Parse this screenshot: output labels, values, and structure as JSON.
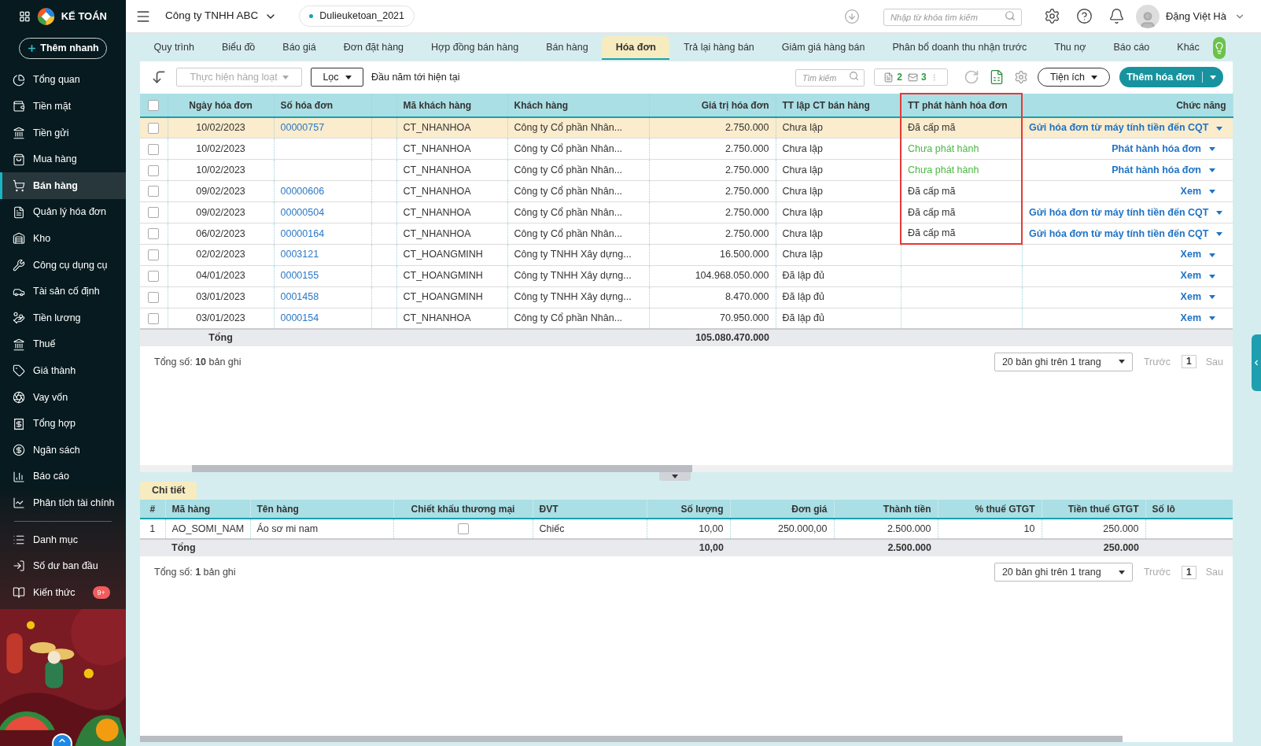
{
  "topbar": {
    "app_name": "KẾ TOÁN",
    "company": "Công ty TNHH ABC",
    "database": "Dulieuketoan_2021",
    "search_placeholder": "Nhập từ khóa tìm kiếm",
    "user": "Đặng Việt Hà"
  },
  "sidebar": {
    "quick_add": "Thêm nhanh",
    "sections": [
      {
        "items": [
          {
            "label": "Tổng quan",
            "selected": false
          },
          {
            "label": "Tiền mặt",
            "selected": false
          },
          {
            "label": "Tiền gửi",
            "selected": false
          },
          {
            "label": "Mua hàng",
            "selected": false
          },
          {
            "label": "Bán hàng",
            "selected": true
          },
          {
            "label": "Quản lý hóa đơn",
            "selected": false
          },
          {
            "label": "Kho",
            "selected": false
          },
          {
            "label": "Công cụ dụng cụ",
            "selected": false
          },
          {
            "label": "Tài sản cố định",
            "selected": false
          },
          {
            "label": "Tiền lương",
            "selected": false
          },
          {
            "label": "Thuế",
            "selected": false
          },
          {
            "label": "Giá thành",
            "selected": false
          },
          {
            "label": "Vay vốn",
            "selected": false
          },
          {
            "label": "Tổng hợp",
            "selected": false
          },
          {
            "label": "Ngân sách",
            "selected": false
          },
          {
            "label": "Báo cáo",
            "selected": false
          },
          {
            "label": "Phân tích tài chính",
            "selected": false
          }
        ]
      },
      {
        "items": [
          {
            "label": "Danh mục",
            "selected": false
          },
          {
            "label": "Số dư ban đầu",
            "selected": false
          },
          {
            "label": "Kiến thức",
            "selected": false,
            "badge": "9+"
          }
        ]
      }
    ]
  },
  "tabs": [
    {
      "label": "Quy trình",
      "selected": false
    },
    {
      "label": "Biểu đồ",
      "selected": false
    },
    {
      "label": "Báo giá",
      "selected": false
    },
    {
      "label": "Đơn đặt hàng",
      "selected": false
    },
    {
      "label": "Hợp đồng bán hàng",
      "selected": false
    },
    {
      "label": "Bán hàng",
      "selected": false
    },
    {
      "label": "Hóa đơn",
      "selected": true
    },
    {
      "label": "Trả lại hàng bán",
      "selected": false
    },
    {
      "label": "Giảm giá hàng bán",
      "selected": false
    },
    {
      "label": "Phân bổ doanh thu nhận trước",
      "selected": false
    },
    {
      "label": "Thu nợ",
      "selected": false
    },
    {
      "label": "Báo cáo",
      "selected": false
    },
    {
      "label": "Khác",
      "selected": false
    }
  ],
  "toolbar": {
    "bulk_action": "Thực hiện hàng loạt",
    "filter": "Lọc",
    "period": "Đầu năm tới hiện tại",
    "search_placeholder": "Tìm kiếm",
    "doc_count": "2",
    "mail_count": "3",
    "utilities": "Tiện ích",
    "add_button": "Thêm hóa đơn"
  },
  "table": {
    "select_all_checked": false,
    "columns": [
      {
        "label": "Ngày hóa đơn"
      },
      {
        "label": "Số hóa đơn"
      },
      {
        "label": "Mã khách hàng"
      },
      {
        "label": "Khách hàng"
      },
      {
        "label": "Giá trị hóa đơn"
      },
      {
        "label": "TT lập CT bán hàng"
      },
      {
        "label": "TT phát hành hóa đơn",
        "highlighted": true
      },
      {
        "label": "Chức năng"
      }
    ],
    "rows": [
      {
        "selected": true,
        "checked": false,
        "date": "10/02/2023",
        "number": "00000757",
        "customer_code": "CT_NHANHOA",
        "customer": "Công ty Cổ phần Nhân...",
        "amount": "2.750.000",
        "entry_status": "Chưa lập",
        "issue_status": {
          "text": "Đã cấp mã",
          "color": "#333333"
        },
        "issue_highlighted": true,
        "action": "Gửi hóa đơn từ máy tính tiền đến CQT"
      },
      {
        "selected": false,
        "checked": false,
        "date": "10/02/2023",
        "customer_code": "CT_NHANHOA",
        "customer": "Công ty Cổ phần Nhân...",
        "amount": "2.750.000",
        "entry_status": "Chưa lập",
        "issue_status": {
          "text": "Chưa phát hành",
          "color": "#4cb843"
        },
        "issue_highlighted": true,
        "action": "Phát hành hóa đơn"
      },
      {
        "selected": false,
        "checked": false,
        "date": "10/02/2023",
        "customer_code": "CT_NHANHOA",
        "customer": "Công ty Cổ phần Nhân...",
        "amount": "2.750.000",
        "entry_status": "Chưa lập",
        "issue_status": {
          "text": "Chưa phát hành",
          "color": "#4cb843"
        },
        "issue_highlighted": true,
        "action": "Phát hành hóa đơn"
      },
      {
        "selected": false,
        "checked": false,
        "date": "09/02/2023",
        "number": "00000606",
        "customer_code": "CT_NHANHOA",
        "customer": "Công ty Cổ phần Nhân...",
        "amount": "2.750.000",
        "entry_status": "Chưa lập",
        "issue_status": {
          "text": "Đã cấp mã",
          "color": "#333333"
        },
        "issue_highlighted": true,
        "action": "Xem"
      },
      {
        "selected": false,
        "checked": false,
        "date": "09/02/2023",
        "number": "00000504",
        "customer_code": "CT_NHANHOA",
        "customer": "Công ty Cổ phần Nhân...",
        "amount": "2.750.000",
        "entry_status": "Chưa lập",
        "issue_status": {
          "text": "Đã cấp mã",
          "color": "#333333"
        },
        "issue_highlighted": true,
        "action": "Gửi hóa đơn từ máy tính tiền đến CQT"
      },
      {
        "selected": false,
        "checked": false,
        "date": "06/02/2023",
        "number": "00000164",
        "customer_code": "CT_NHANHOA",
        "customer": "Công ty Cổ phần Nhân...",
        "amount": "2.750.000",
        "entry_status": "Chưa lập",
        "issue_status": {
          "text": "Đã cấp mã",
          "color": "#333333"
        },
        "issue_highlighted": true,
        "action": "Gửi hóa đơn từ máy tính tiền đến CQT"
      },
      {
        "selected": false,
        "checked": false,
        "date": "02/02/2023",
        "number": "0003121",
        "customer_code": "CT_HOANGMINH",
        "customer": "Công ty TNHH Xây dựng...",
        "amount": "16.500.000",
        "entry_status": "Chưa lập",
        "issue_highlighted": false,
        "action": "Xem"
      },
      {
        "selected": false,
        "checked": false,
        "date": "04/01/2023",
        "number": "0000155",
        "customer_code": "CT_HOANGMINH",
        "customer": "Công ty TNHH Xây dựng...",
        "amount": "104.968.050.000",
        "entry_status": "Đã lập đủ",
        "issue_highlighted": false,
        "action": "Xem"
      },
      {
        "selected": false,
        "checked": false,
        "date": "03/01/2023",
        "number": "0001458",
        "customer_code": "CT_HOANGMINH",
        "customer": "Công ty TNHH Xây dựng...",
        "amount": "8.470.000",
        "entry_status": "Đã lập đủ",
        "issue_highlighted": false,
        "action": "Xem"
      },
      {
        "selected": false,
        "checked": false,
        "date": "03/01/2023",
        "number": "0000154",
        "customer_code": "CT_NHANHOA",
        "customer": "Công ty Cổ phần Nhân...",
        "amount": "70.950.000",
        "entry_status": "Đã lập đủ",
        "issue_highlighted": false,
        "action": "Xem"
      }
    ],
    "total": {
      "label": "Tổng",
      "amount": "105.080.470.000"
    },
    "record_count": "Tổng số: **10** bản ghi",
    "pager": {
      "page_size": "20 bản ghi trên 1 trang",
      "prev": "Trước",
      "page": "1",
      "next": "Sau"
    }
  },
  "detail": {
    "tab": "Chi tiết",
    "columns": [
      "#",
      "Mã hàng",
      "Tên hàng",
      "Chiết khấu thương mại",
      "ĐVT",
      "Số lượng",
      "Đơn giá",
      "Thành tiền",
      "% thuế GTGT",
      "Tiền thuế GTGT",
      "Số lô"
    ],
    "rows": [
      {
        "index": "1",
        "code": "AO_SOMI_NAM",
        "name": "Áo sơ mi nam",
        "discount_checked": false,
        "unit": "Chiếc",
        "quantity": "10,00",
        "price": "250.000,00",
        "line_total": "2.500.000",
        "vat_rate": "10",
        "vat": "250.000"
      }
    ],
    "total": {
      "label": "Tổng",
      "quantity": "10,00",
      "line_total": "2.500.000",
      "vat": "250.000"
    },
    "record_count": "Tổng số: **1** bản ghi",
    "pager": {
      "page_size": "20 bản ghi trên 1 trang",
      "prev": "Trước",
      "page": "1",
      "next": "Sau"
    }
  }
}
